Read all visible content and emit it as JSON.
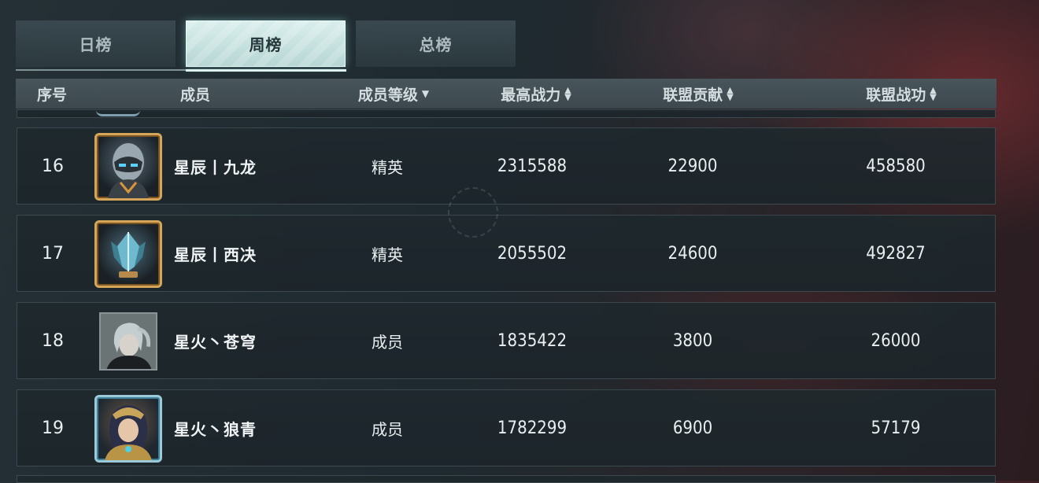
{
  "tabs": [
    {
      "label": "日榜",
      "active": false
    },
    {
      "label": "周榜",
      "active": true
    },
    {
      "label": "总榜",
      "active": false
    }
  ],
  "columns": {
    "rank": "序号",
    "member": "成员",
    "level": "成员等级",
    "max_power": "最高战力",
    "contribution": "联盟贡献",
    "merit": "联盟战功"
  },
  "rows": [
    {
      "rank": "16",
      "name": "星辰丨九龙",
      "level": "精英",
      "max_power": "2315588",
      "contribution": "22900",
      "merit": "458580",
      "avatar": "armored-robot-avatar",
      "frame": "gold"
    },
    {
      "rank": "17",
      "name": "星辰丨西决",
      "level": "精英",
      "max_power": "2055502",
      "contribution": "24600",
      "merit": "492827",
      "avatar": "crystal-emblem-avatar",
      "frame": "gold"
    },
    {
      "rank": "18",
      "name": "星火丶苍穹",
      "level": "成员",
      "max_power": "1835422",
      "contribution": "3800",
      "merit": "26000",
      "avatar": "silver-haired-character-avatar",
      "frame": "plain"
    },
    {
      "rank": "19",
      "name": "星火丶狼青",
      "level": "成员",
      "max_power": "1782299",
      "contribution": "6900",
      "merit": "57179",
      "avatar": "hooded-warrior-avatar",
      "frame": "blue"
    }
  ]
}
